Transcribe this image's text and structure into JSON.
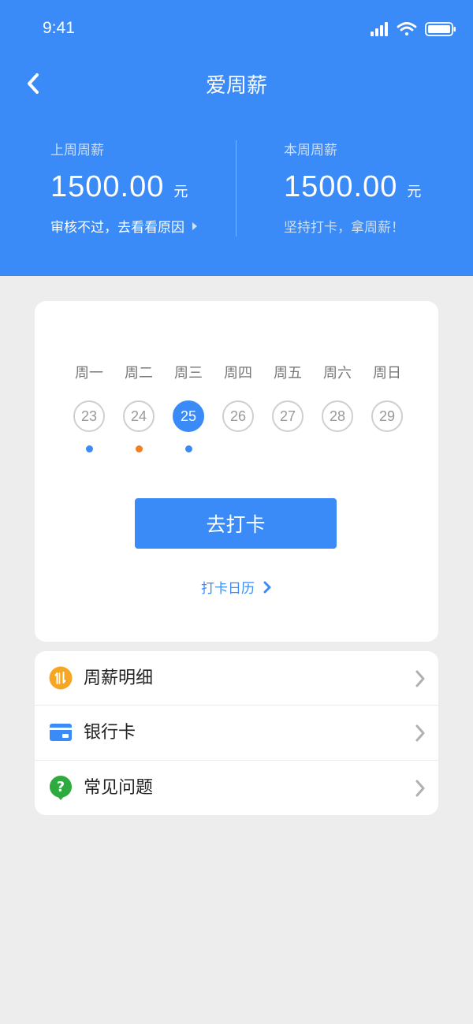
{
  "status_bar": {
    "time": "9:41"
  },
  "nav": {
    "title": "爱周薪"
  },
  "salary": {
    "last_week": {
      "label": "上周周薪",
      "amount": "1500.00",
      "unit": "元",
      "note": "审核不过，去看看原因"
    },
    "this_week": {
      "label": "本周周薪",
      "amount": "1500.00",
      "unit": "元",
      "note": "坚持打卡，拿周薪！"
    }
  },
  "week": {
    "days": [
      {
        "name": "周一",
        "date": "23",
        "dot": "#3a8bf7"
      },
      {
        "name": "周二",
        "date": "24",
        "dot": "#f08020"
      },
      {
        "name": "周三",
        "date": "25",
        "dot": "#3a8bf7",
        "active": true
      },
      {
        "name": "周四",
        "date": "26"
      },
      {
        "name": "周五",
        "date": "27"
      },
      {
        "name": "周六",
        "date": "28"
      },
      {
        "name": "周日",
        "date": "29"
      }
    ]
  },
  "checkin": {
    "button_label": "去打卡",
    "calendar_link": "打卡日历"
  },
  "menu": {
    "items": [
      {
        "label": "周薪明细",
        "icon": "salary-detail-icon"
      },
      {
        "label": "银行卡",
        "icon": "bank-card-icon"
      },
      {
        "label": "常见问题",
        "icon": "faq-icon"
      }
    ]
  },
  "colors": {
    "primary": "#3a8bf7",
    "background": "#ededed",
    "dot_blue": "#3a8bf7",
    "dot_orange": "#f08020",
    "icon_orange": "#f5a623",
    "icon_green": "#2eaa3f"
  }
}
